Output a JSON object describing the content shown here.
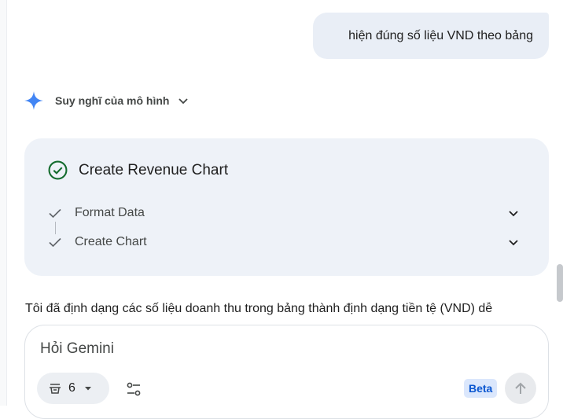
{
  "user_message": {
    "text": "hiện đúng số liệu VND theo bảng"
  },
  "thinking": {
    "label": "Suy nghĩ của mô hình",
    "icon": "sparkle-icon"
  },
  "task_card": {
    "title": "Create Revenue Chart",
    "status_icon": "check-circle-icon",
    "steps": [
      {
        "label": "Format Data"
      },
      {
        "label": "Create Chart"
      }
    ]
  },
  "response": {
    "text": "Tôi đã định dạng các số liệu doanh thu trong bảng thành định dạng tiền tệ (VND) dễ"
  },
  "composer": {
    "placeholder": "Hỏi Gemini",
    "tools_count": "6",
    "beta_label": "Beta"
  },
  "colors": {
    "accent": "#0b57d0",
    "success": "#146c2e",
    "card_bg": "#eef2f8",
    "bubble_bg": "#e9eef6"
  }
}
